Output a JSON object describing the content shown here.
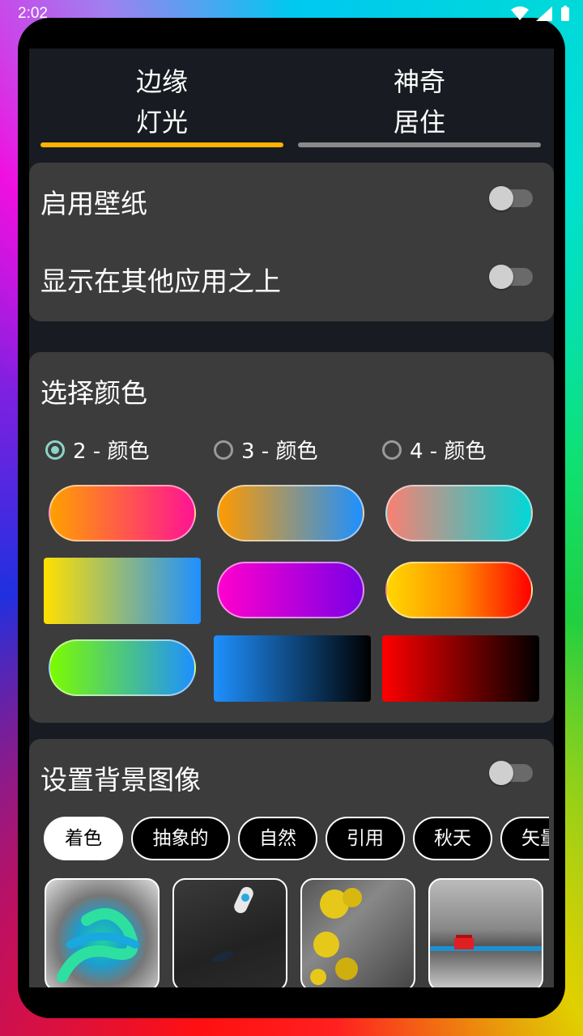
{
  "status_bar": {
    "time": "2:02",
    "icons": "wifi-icon signal-icon battery-icon"
  },
  "tabs": [
    {
      "label_line1": "边缘",
      "label_line2": "灯光",
      "active": true,
      "bar_color": "#ffb300"
    },
    {
      "label_line1": "神奇",
      "label_line2": "居住",
      "active": false,
      "bar_color": "#8a8a8a"
    }
  ],
  "settings": {
    "enable_wallpaper": {
      "label": "启用壁纸",
      "on": false
    },
    "display_over_apps": {
      "label": "显示在其他应用之上",
      "on": false
    }
  },
  "color_section": {
    "title": "选择颜色",
    "options": [
      {
        "label": "2 - 颜色",
        "selected": true
      },
      {
        "label": "3 - 颜色",
        "selected": false
      },
      {
        "label": "4 - 颜色",
        "selected": false
      }
    ],
    "swatches": [
      {
        "colors": [
          "#ffa000",
          "#ff1493"
        ]
      },
      {
        "colors": [
          "#ff9a00",
          "#1e90ff"
        ]
      },
      {
        "colors": [
          "#fa8072",
          "#00d8d8"
        ]
      },
      {
        "colors": [
          "#ffe000",
          "#1e90ff"
        ]
      },
      {
        "colors": [
          "#ff00cc",
          "#7a00e6"
        ]
      },
      {
        "colors": [
          "#ffd700",
          "#ff8c00",
          "#ff0000"
        ]
      },
      {
        "colors": [
          "#7cfc00",
          "#1e90ff"
        ]
      },
      {
        "colors": [
          "#1e90ff",
          "#000000"
        ]
      },
      {
        "colors": [
          "#ff0000",
          "#000000"
        ]
      }
    ]
  },
  "background_section": {
    "title": "设置背景图像",
    "on": false,
    "categories": [
      {
        "label": "着色",
        "selected": true
      },
      {
        "label": "抽象的",
        "selected": false
      },
      {
        "label": "自然",
        "selected": false
      },
      {
        "label": "引用",
        "selected": false
      },
      {
        "label": "秋天",
        "selected": false
      },
      {
        "label": "矢量",
        "selected": false
      }
    ],
    "thumbnails": [
      "snake-image",
      "boat-image",
      "flowers-coast-image",
      "beach-hut-image"
    ]
  }
}
